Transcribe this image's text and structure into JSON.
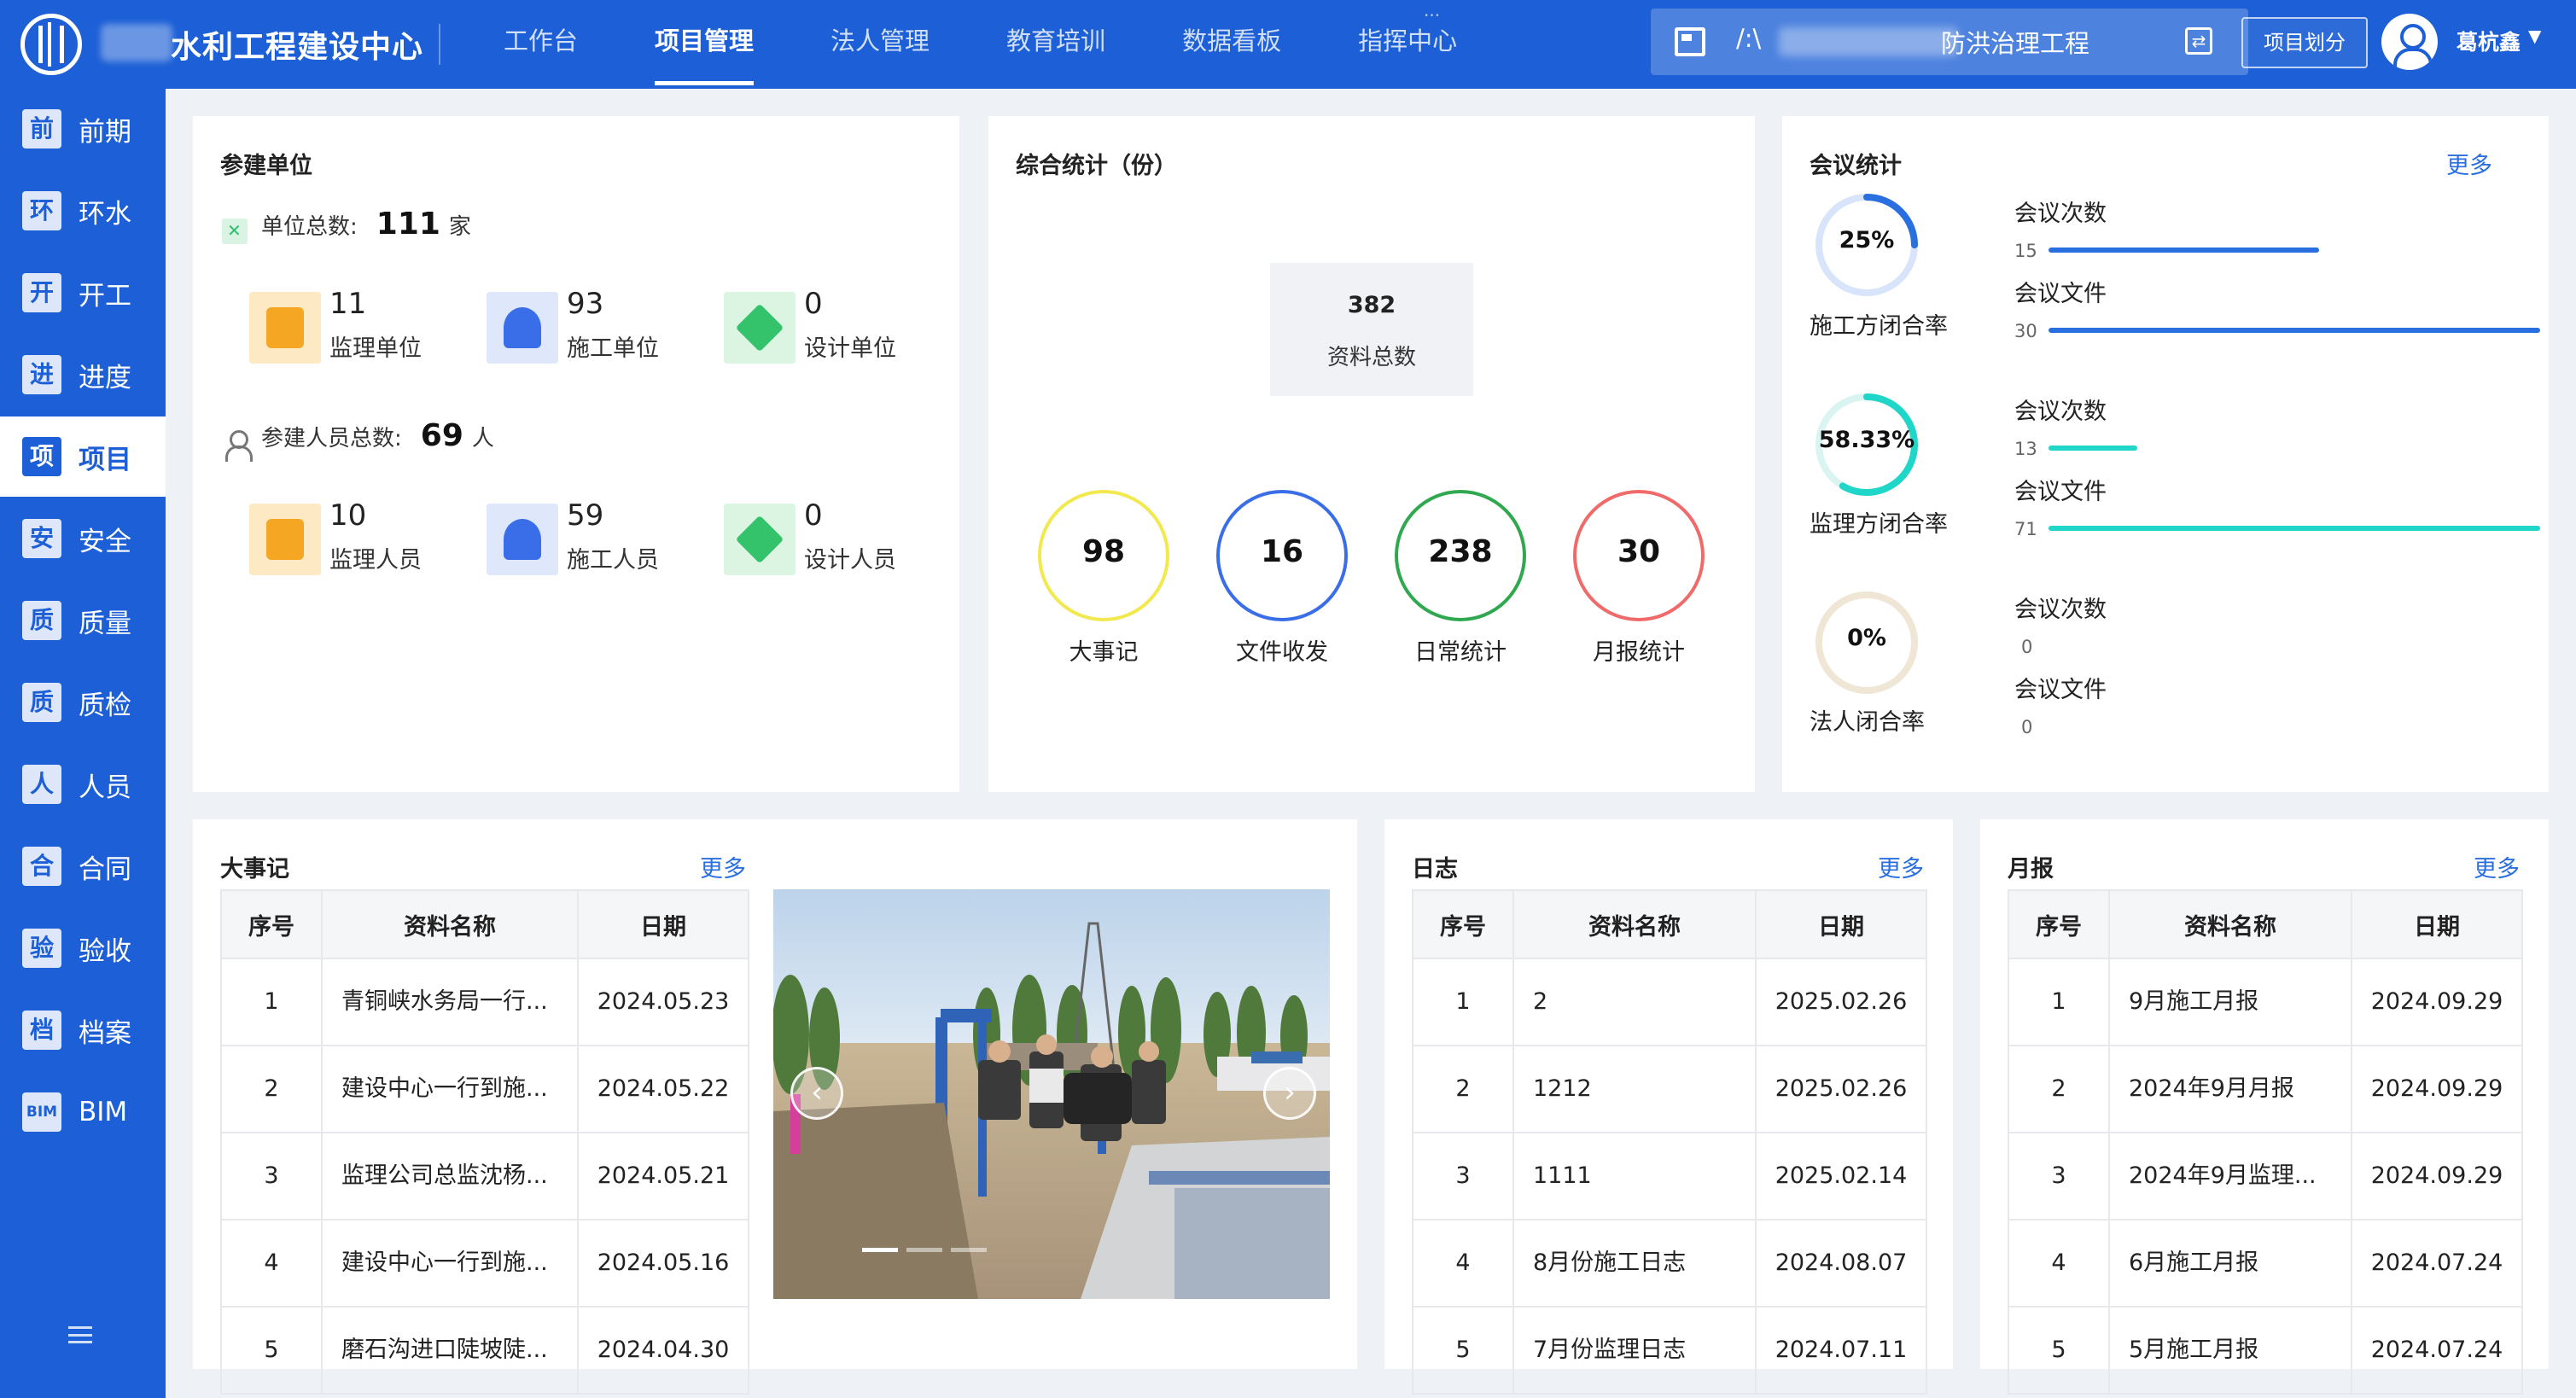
{
  "header": {
    "org_name": "水利工程建设中心",
    "nav": [
      "工作台",
      "项目管理",
      "法人管理",
      "教育培训",
      "数据看板",
      "指挥中心"
    ],
    "nav_active": 1,
    "project_prefix": "/:\\",
    "project_name": "防洪治理工程",
    "split_button": "项目划分",
    "username": "葛杭鑫"
  },
  "sidebar": {
    "items": [
      {
        "badge": "前",
        "label": "前期"
      },
      {
        "badge": "环",
        "label": "环水"
      },
      {
        "badge": "开",
        "label": "开工"
      },
      {
        "badge": "进",
        "label": "进度"
      },
      {
        "badge": "项",
        "label": "项目"
      },
      {
        "badge": "安",
        "label": "安全"
      },
      {
        "badge": "质",
        "label": "质量"
      },
      {
        "badge": "质",
        "label": "质检"
      },
      {
        "badge": "人",
        "label": "人员"
      },
      {
        "badge": "合",
        "label": "合同"
      },
      {
        "badge": "验",
        "label": "验收"
      },
      {
        "badge": "档",
        "label": "档案"
      },
      {
        "badge": "BIM",
        "label": "BIM"
      }
    ],
    "active_index": 4
  },
  "participants": {
    "title": "参建单位",
    "unit_total_label": "单位总数:",
    "unit_total": "111",
    "unit_suffix": "家",
    "units": [
      {
        "num": "11",
        "label": "监理单位",
        "color": "orange"
      },
      {
        "num": "93",
        "label": "施工单位",
        "color": "blue"
      },
      {
        "num": "0",
        "label": "设计单位",
        "color": "green"
      }
    ],
    "people_total_label": "参建人员总数:",
    "people_total": "69",
    "people_suffix": "人",
    "people": [
      {
        "num": "10",
        "label": "监理人员",
        "color": "orange"
      },
      {
        "num": "59",
        "label": "施工人员",
        "color": "blue"
      },
      {
        "num": "0",
        "label": "设计人员",
        "color": "green"
      }
    ]
  },
  "summary": {
    "title": "综合统计（份）",
    "total_value": "382",
    "total_label": "资料总数",
    "rings": [
      {
        "num": "98",
        "label": "大事记",
        "color": "#f2e94e"
      },
      {
        "num": "16",
        "label": "文件收发",
        "color": "#3a6ee8"
      },
      {
        "num": "238",
        "label": "日常统计",
        "color": "#2fa84f"
      },
      {
        "num": "30",
        "label": "月报统计",
        "color": "#f06a6a"
      }
    ]
  },
  "meetings": {
    "title": "会议统计",
    "more": "更多",
    "groups": [
      {
        "rate": "25%",
        "rate_value": 0.25,
        "label": "施工方闭合率",
        "color": "#2a6fe0",
        "track": "#d8e4fa",
        "count_label": "会议次数",
        "count": "15",
        "count_frac": 0.55,
        "file_label": "会议文件",
        "file": "30",
        "file_frac": 1.0
      },
      {
        "rate": "58.33%",
        "rate_value": 0.5833,
        "label": "监理方闭合率",
        "color": "#1fd6c8",
        "track": "#daf4f2",
        "count_label": "会议次数",
        "count": "13",
        "count_frac": 0.18,
        "file_label": "会议文件",
        "file": "71",
        "file_frac": 1.0
      },
      {
        "rate": "0%",
        "rate_value": 0,
        "label": "法人闭合率",
        "color": "#e0c89a",
        "track": "#efe6d6",
        "count_label": "会议次数",
        "count": "0",
        "count_frac": 0,
        "file_label": "会议文件",
        "file": "0",
        "file_frac": 0
      }
    ]
  },
  "events": {
    "title": "大事记",
    "more": "更多",
    "columns": [
      "序号",
      "资料名称",
      "日期"
    ],
    "rows": [
      [
        "1",
        "青铜峡水务局一行...",
        "2024.05.23"
      ],
      [
        "2",
        "建设中心一行到施...",
        "2024.05.22"
      ],
      [
        "3",
        "监理公司总监沈杨...",
        "2024.05.21"
      ],
      [
        "4",
        "建设中心一行到施...",
        "2024.05.16"
      ],
      [
        "5",
        "磨石沟进口陡坡陡...",
        "2024.04.30"
      ]
    ]
  },
  "logs": {
    "title": "日志",
    "more": "更多",
    "columns": [
      "序号",
      "资料名称",
      "日期"
    ],
    "rows": [
      [
        "1",
        "2",
        "2025.02.26"
      ],
      [
        "2",
        "1212",
        "2025.02.26"
      ],
      [
        "3",
        "1111",
        "2025.02.14"
      ],
      [
        "4",
        "8月份施工日志",
        "2024.08.07"
      ],
      [
        "5",
        "7月份监理日志",
        "2024.07.11"
      ]
    ]
  },
  "monthly": {
    "title": "月报",
    "more": "更多",
    "columns": [
      "序号",
      "资料名称",
      "日期"
    ],
    "rows": [
      [
        "1",
        "9月施工月报",
        "2024.09.29"
      ],
      [
        "2",
        "2024年9月月报",
        "2024.09.29"
      ],
      [
        "3",
        "2024年9月监理...",
        "2024.09.29"
      ],
      [
        "4",
        "6月施工月报",
        "2024.07.24"
      ],
      [
        "5",
        "5月施工月报",
        "2024.07.24"
      ]
    ]
  },
  "carousel": {
    "prev": "‹",
    "next": "›",
    "slides": 3,
    "active": 0
  }
}
